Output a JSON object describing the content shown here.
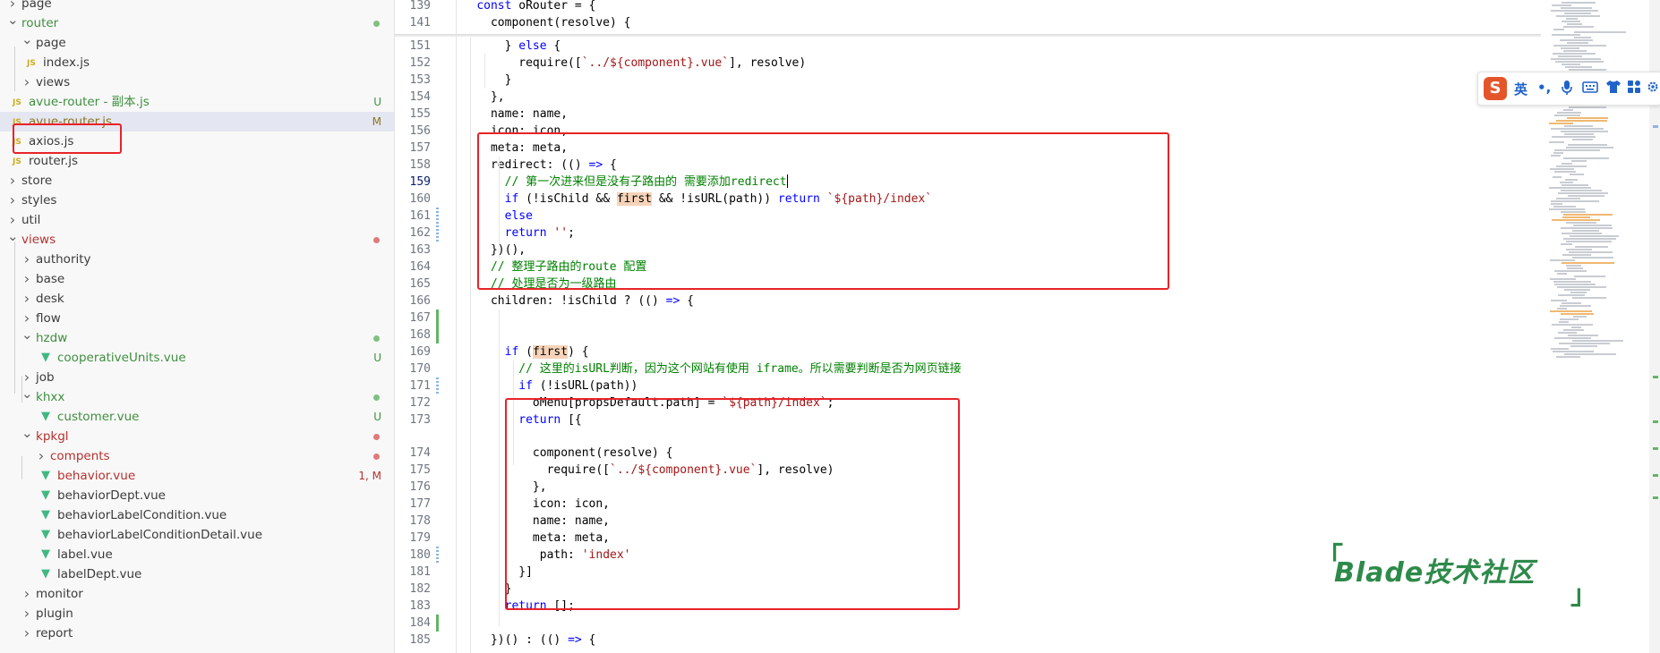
{
  "sidebar": {
    "items": [
      {
        "label": "page",
        "type": "folder",
        "state": "collapsed"
      },
      {
        "label": "router",
        "type": "folder",
        "state": "expanded",
        "status": "dot-green"
      },
      {
        "label": "page",
        "type": "folder",
        "state": "expanded"
      },
      {
        "label": "index.js",
        "type": "js"
      },
      {
        "label": "views",
        "type": "folder",
        "state": "collapsed"
      },
      {
        "label": "avue-router - 副本.js",
        "type": "js",
        "badge": "U"
      },
      {
        "label": "avue-router.js",
        "type": "js",
        "badge": "M",
        "selected": true
      },
      {
        "label": "axios.js",
        "type": "js"
      },
      {
        "label": "router.js",
        "type": "js"
      },
      {
        "label": "store",
        "type": "folder",
        "state": "collapsed"
      },
      {
        "label": "styles",
        "type": "folder",
        "state": "collapsed"
      },
      {
        "label": "util",
        "type": "folder",
        "state": "collapsed"
      },
      {
        "label": "views",
        "type": "folder",
        "state": "expanded",
        "status": "dot-red"
      },
      {
        "label": "authority",
        "type": "folder",
        "state": "collapsed"
      },
      {
        "label": "base",
        "type": "folder",
        "state": "collapsed"
      },
      {
        "label": "desk",
        "type": "folder",
        "state": "collapsed"
      },
      {
        "label": "flow",
        "type": "folder",
        "state": "collapsed"
      },
      {
        "label": "hzdw",
        "type": "folder",
        "state": "expanded",
        "status": "dot-green"
      },
      {
        "label": "cooperativeUnits.vue",
        "type": "vue",
        "badge": "U"
      },
      {
        "label": "job",
        "type": "folder",
        "state": "collapsed"
      },
      {
        "label": "khxx",
        "type": "folder",
        "state": "expanded",
        "status": "dot-green"
      },
      {
        "label": "customer.vue",
        "type": "vue",
        "badge": "U"
      },
      {
        "label": "kpkgl",
        "type": "folder",
        "state": "expanded",
        "status": "dot-red"
      },
      {
        "label": "compents",
        "type": "folder",
        "state": "collapsed",
        "status": "dot-red"
      },
      {
        "label": "behavior.vue",
        "type": "vue",
        "badge": "1, M"
      },
      {
        "label": "behaviorDept.vue",
        "type": "vue"
      },
      {
        "label": "behaviorLabelCondition.vue",
        "type": "vue"
      },
      {
        "label": "behaviorLabelConditionDetail.vue",
        "type": "vue"
      },
      {
        "label": "label.vue",
        "type": "vue"
      },
      {
        "label": "labelDept.vue",
        "type": "vue"
      },
      {
        "label": "monitor",
        "type": "folder",
        "state": "collapsed"
      },
      {
        "label": "plugin",
        "type": "folder",
        "state": "collapsed"
      },
      {
        "label": "report",
        "type": "folder",
        "state": "collapsed"
      }
    ]
  },
  "editor": {
    "lines": [
      {
        "num": "139",
        "code": "    const oRouter = {"
      },
      {
        "num": "141",
        "code": "      component(resolve) {"
      },
      {
        "num": "151",
        "code": "        } else {"
      },
      {
        "num": "152",
        "code": "          require([`../${component}.vue`], resolve)"
      },
      {
        "num": "153",
        "code": "        }"
      },
      {
        "num": "154",
        "code": "      },"
      },
      {
        "num": "155",
        "code": "      name: name,"
      },
      {
        "num": "156",
        "code": "      icon: icon,"
      },
      {
        "num": "157",
        "code": "      meta: meta,"
      },
      {
        "num": "158",
        "code": "      redirect: (() => {"
      },
      {
        "num": "159",
        "code": "        // 第一次进来但是没有子路由的 需要添加redirect"
      },
      {
        "num": "160",
        "code": "        if (!isChild && first && !isURL(path)) return `${path}/index`"
      },
      {
        "num": "161",
        "code": "        else"
      },
      {
        "num": "162",
        "code": "        return '';"
      },
      {
        "num": "163",
        "code": "      })(),"
      },
      {
        "num": "164",
        "code": "      // 整理子路由的route 配置"
      },
      {
        "num": "165",
        "code": "      // 处理是否为一级路由"
      },
      {
        "num": "166",
        "code": "      children: !isChild ? (() => {"
      },
      {
        "num": "167",
        "code": ""
      },
      {
        "num": "168",
        "code": ""
      },
      {
        "num": "169",
        "code": "        if (first) {"
      },
      {
        "num": "170",
        "code": "          // 这里的isURL判断，因为这个网站有使用 iframe。所以需要判断是否为网页链接"
      },
      {
        "num": "171",
        "code": "          if (!isURL(path))"
      },
      {
        "num": "172",
        "code": "            oMenu[propsDefault.path] = `${path}/index`;"
      },
      {
        "num": "173",
        "code": "          return [{"
      },
      {
        "num": "174",
        "code": "            component(resolve) {"
      },
      {
        "num": "175",
        "code": "              require([`../${component}.vue`], resolve)"
      },
      {
        "num": "176",
        "code": "            },"
      },
      {
        "num": "177",
        "code": "            icon: icon,"
      },
      {
        "num": "178",
        "code": "            name: name,"
      },
      {
        "num": "179",
        "code": "            meta: meta,"
      },
      {
        "num": "180",
        "code": "             path: 'index'"
      },
      {
        "num": "181",
        "code": "          }]"
      },
      {
        "num": "182",
        "code": "        }"
      },
      {
        "num": "183",
        "code": "        return [];"
      },
      {
        "num": "184",
        "code": ""
      },
      {
        "num": "185",
        "code": "      })() : (() => {"
      }
    ]
  },
  "ime": {
    "items": [
      "英",
      "•,",
      "mic-icon",
      "keyboard-icon",
      "shirt-icon",
      "grid-icon",
      "settings-icon"
    ],
    "logo": "S"
  },
  "watermark": {
    "text": "Blade技术社区"
  },
  "colors": {
    "keyword": "#0000ff",
    "string": "#a31515",
    "comment": "#008000",
    "annotation": "#e8232a",
    "watermark": "#2e8a4a"
  }
}
